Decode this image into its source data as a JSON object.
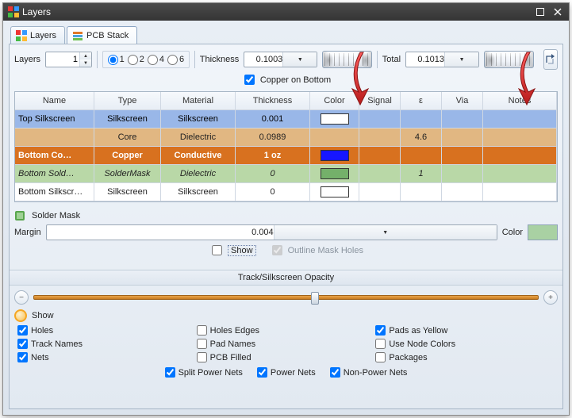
{
  "window": {
    "title": "Layers"
  },
  "tabs": {
    "layers": "Layers",
    "stack": "PCB Stack",
    "active": 1
  },
  "row1": {
    "layersLabel": "Layers",
    "layersValue": "1",
    "radios": [
      "1",
      "2",
      "4",
      "6"
    ],
    "radioSelected": 0,
    "thicknessLabel": "Thickness",
    "thicknessValue": "0.1003",
    "totalLabel": "Total",
    "totalValue": "0.1013"
  },
  "copperBottom": {
    "label": "Copper on Bottom",
    "checked": true
  },
  "columns": [
    "Name",
    "Type",
    "Material",
    "Thickness",
    "Color",
    "Signal",
    "ε",
    "Via",
    "Notes"
  ],
  "rows": [
    {
      "theme": "r-blue",
      "cells": [
        "Top Silkscreen",
        "Silkscreen",
        "Silkscreen",
        "0.001",
        "",
        "",
        "",
        "",
        ""
      ],
      "swatch": "#ffffff"
    },
    {
      "theme": "r-tan",
      "cells": [
        "",
        "Core",
        "Dielectric",
        "0.0989",
        "",
        "",
        "4.6",
        "",
        ""
      ],
      "swatch": null
    },
    {
      "theme": "r-orange",
      "cells": [
        "Bottom Co…",
        "Copper",
        "Conductive",
        "1 oz",
        "",
        "",
        "",
        "",
        ""
      ],
      "swatch": "#1616ff"
    },
    {
      "theme": "r-green",
      "cells": [
        "Bottom Sold…",
        "SolderMask",
        "Dielectric",
        "0",
        "",
        "",
        "1",
        "",
        ""
      ],
      "swatch": "#74b06a"
    },
    {
      "theme": "r-white",
      "cells": [
        "Bottom Silkscr…",
        "Silkscreen",
        "Silkscreen",
        "0",
        "",
        "",
        "",
        "",
        ""
      ],
      "swatch": "#ffffff"
    }
  ],
  "solderMask": {
    "title": "Solder Mask",
    "marginLabel": "Margin",
    "marginValue": "0.004",
    "colorLabel": "Color",
    "color": "#a9d1a3",
    "showLabel": "Show",
    "showChecked": false,
    "outlineLabel": "Outline Mask Holes",
    "outlineChecked": true
  },
  "opacity": {
    "title": "Track/Silkscreen Opacity",
    "showLabel": "Show"
  },
  "checks": {
    "c0": {
      "label": "Holes",
      "checked": true
    },
    "c1": {
      "label": "Holes Edges",
      "checked": false
    },
    "c2": {
      "label": "Pads as Yellow",
      "checked": true
    },
    "c3": {
      "label": "Track Names",
      "checked": true
    },
    "c4": {
      "label": "Pad Names",
      "checked": false
    },
    "c5": {
      "label": "Use Node Colors",
      "checked": false
    },
    "c6": {
      "label": "Nets",
      "checked": true
    },
    "c7": {
      "label": "PCB Filled",
      "checked": false
    },
    "c8": {
      "label": "Packages",
      "checked": false
    },
    "b0": {
      "label": "Split Power Nets",
      "checked": true
    },
    "b1": {
      "label": "Power Nets",
      "checked": true
    },
    "b2": {
      "label": "Non-Power Nets",
      "checked": true
    }
  }
}
